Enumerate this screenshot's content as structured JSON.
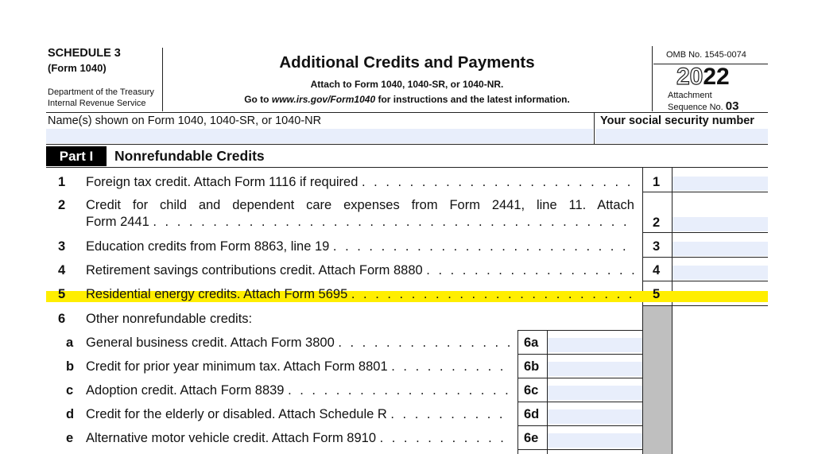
{
  "header": {
    "schedule": "SCHEDULE 3",
    "form_ref": "(Form 1040)",
    "dept_line1": "Department of the Treasury",
    "dept_line2": "Internal Revenue Service",
    "title": "Additional Credits and Payments",
    "attach_line": "Attach to Form 1040, 1040-SR, or 1040-NR.",
    "goto_prefix": "Go to ",
    "goto_url": "www.irs.gov/Form1040",
    "goto_suffix": " for instructions and the latest information.",
    "omb": "OMB No. 1545-0074",
    "year_light": "20",
    "year_bold": "22",
    "attachment_label": "Attachment",
    "sequence_label": "Sequence No.",
    "sequence_no": "03"
  },
  "name_field": {
    "label": "Name(s) shown on Form 1040, 1040-SR, or 1040-NR",
    "value": ""
  },
  "ssn_field": {
    "label": "Your social security number",
    "value": ""
  },
  "part": {
    "tag": "Part I",
    "title": "Nonrefundable Credits"
  },
  "lines": {
    "l1": {
      "num": "1",
      "text": "Foreign tax credit. Attach Form 1116 if required",
      "box": "1",
      "value": ""
    },
    "l2": {
      "num": "2",
      "text1": "Credit for child and dependent care expenses from Form 2441, line 11. Attach",
      "text2": "Form 2441",
      "box": "2",
      "value": ""
    },
    "l3": {
      "num": "3",
      "text": "Education credits from Form 8863, line 19",
      "box": "3",
      "value": ""
    },
    "l4": {
      "num": "4",
      "text": "Retirement savings contributions credit. Attach Form 8880",
      "box": "4",
      "value": ""
    },
    "l5": {
      "num": "5",
      "text": "Residential energy credits. Attach Form 5695",
      "box": "5",
      "value": ""
    },
    "l6": {
      "num": "6",
      "text": "Other nonrefundable credits:"
    },
    "l6a": {
      "letter": "a",
      "text": "General business credit. Attach Form 3800",
      "box": "6a",
      "value": ""
    },
    "l6b": {
      "letter": "b",
      "text": "Credit for prior year minimum tax. Attach Form 8801",
      "box": "6b",
      "value": ""
    },
    "l6c": {
      "letter": "c",
      "text": "Adoption credit. Attach Form 8839",
      "box": "6c",
      "value": ""
    },
    "l6d": {
      "letter": "d",
      "text": "Credit for the elderly or disabled. Attach Schedule R",
      "box": "6d",
      "value": ""
    },
    "l6e": {
      "letter": "e",
      "text": "Alternative motor vehicle credit. Attach Form 8910",
      "box": "6e",
      "value": ""
    }
  },
  "dots": ". . . . . . . . . . . . . . . . . . . . . . . . . . . . . . . . . . . . . . . . . . . . . . . . .",
  "colors": {
    "highlight": "#ffee00",
    "field_fill": "#e8eefb",
    "shaded_column": "#bfbfbf",
    "part_tag_bg": "#000000"
  }
}
